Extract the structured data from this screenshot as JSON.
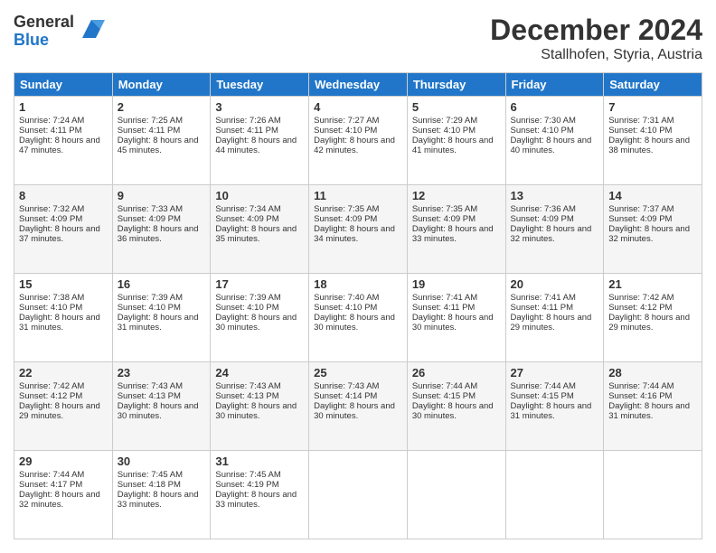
{
  "logo": {
    "general": "General",
    "blue": "Blue"
  },
  "header": {
    "month": "December 2024",
    "location": "Stallhofen, Styria, Austria"
  },
  "weekdays": [
    "Sunday",
    "Monday",
    "Tuesday",
    "Wednesday",
    "Thursday",
    "Friday",
    "Saturday"
  ],
  "weeks": [
    [
      {
        "day": "1",
        "sunrise": "Sunrise: 7:24 AM",
        "sunset": "Sunset: 4:11 PM",
        "daylight": "Daylight: 8 hours and 47 minutes."
      },
      {
        "day": "2",
        "sunrise": "Sunrise: 7:25 AM",
        "sunset": "Sunset: 4:11 PM",
        "daylight": "Daylight: 8 hours and 45 minutes."
      },
      {
        "day": "3",
        "sunrise": "Sunrise: 7:26 AM",
        "sunset": "Sunset: 4:11 PM",
        "daylight": "Daylight: 8 hours and 44 minutes."
      },
      {
        "day": "4",
        "sunrise": "Sunrise: 7:27 AM",
        "sunset": "Sunset: 4:10 PM",
        "daylight": "Daylight: 8 hours and 42 minutes."
      },
      {
        "day": "5",
        "sunrise": "Sunrise: 7:29 AM",
        "sunset": "Sunset: 4:10 PM",
        "daylight": "Daylight: 8 hours and 41 minutes."
      },
      {
        "day": "6",
        "sunrise": "Sunrise: 7:30 AM",
        "sunset": "Sunset: 4:10 PM",
        "daylight": "Daylight: 8 hours and 40 minutes."
      },
      {
        "day": "7",
        "sunrise": "Sunrise: 7:31 AM",
        "sunset": "Sunset: 4:10 PM",
        "daylight": "Daylight: 8 hours and 38 minutes."
      }
    ],
    [
      {
        "day": "8",
        "sunrise": "Sunrise: 7:32 AM",
        "sunset": "Sunset: 4:09 PM",
        "daylight": "Daylight: 8 hours and 37 minutes."
      },
      {
        "day": "9",
        "sunrise": "Sunrise: 7:33 AM",
        "sunset": "Sunset: 4:09 PM",
        "daylight": "Daylight: 8 hours and 36 minutes."
      },
      {
        "day": "10",
        "sunrise": "Sunrise: 7:34 AM",
        "sunset": "Sunset: 4:09 PM",
        "daylight": "Daylight: 8 hours and 35 minutes."
      },
      {
        "day": "11",
        "sunrise": "Sunrise: 7:35 AM",
        "sunset": "Sunset: 4:09 PM",
        "daylight": "Daylight: 8 hours and 34 minutes."
      },
      {
        "day": "12",
        "sunrise": "Sunrise: 7:35 AM",
        "sunset": "Sunset: 4:09 PM",
        "daylight": "Daylight: 8 hours and 33 minutes."
      },
      {
        "day": "13",
        "sunrise": "Sunrise: 7:36 AM",
        "sunset": "Sunset: 4:09 PM",
        "daylight": "Daylight: 8 hours and 32 minutes."
      },
      {
        "day": "14",
        "sunrise": "Sunrise: 7:37 AM",
        "sunset": "Sunset: 4:09 PM",
        "daylight": "Daylight: 8 hours and 32 minutes."
      }
    ],
    [
      {
        "day": "15",
        "sunrise": "Sunrise: 7:38 AM",
        "sunset": "Sunset: 4:10 PM",
        "daylight": "Daylight: 8 hours and 31 minutes."
      },
      {
        "day": "16",
        "sunrise": "Sunrise: 7:39 AM",
        "sunset": "Sunset: 4:10 PM",
        "daylight": "Daylight: 8 hours and 31 minutes."
      },
      {
        "day": "17",
        "sunrise": "Sunrise: 7:39 AM",
        "sunset": "Sunset: 4:10 PM",
        "daylight": "Daylight: 8 hours and 30 minutes."
      },
      {
        "day": "18",
        "sunrise": "Sunrise: 7:40 AM",
        "sunset": "Sunset: 4:10 PM",
        "daylight": "Daylight: 8 hours and 30 minutes."
      },
      {
        "day": "19",
        "sunrise": "Sunrise: 7:41 AM",
        "sunset": "Sunset: 4:11 PM",
        "daylight": "Daylight: 8 hours and 30 minutes."
      },
      {
        "day": "20",
        "sunrise": "Sunrise: 7:41 AM",
        "sunset": "Sunset: 4:11 PM",
        "daylight": "Daylight: 8 hours and 29 minutes."
      },
      {
        "day": "21",
        "sunrise": "Sunrise: 7:42 AM",
        "sunset": "Sunset: 4:12 PM",
        "daylight": "Daylight: 8 hours and 29 minutes."
      }
    ],
    [
      {
        "day": "22",
        "sunrise": "Sunrise: 7:42 AM",
        "sunset": "Sunset: 4:12 PM",
        "daylight": "Daylight: 8 hours and 29 minutes."
      },
      {
        "day": "23",
        "sunrise": "Sunrise: 7:43 AM",
        "sunset": "Sunset: 4:13 PM",
        "daylight": "Daylight: 8 hours and 30 minutes."
      },
      {
        "day": "24",
        "sunrise": "Sunrise: 7:43 AM",
        "sunset": "Sunset: 4:13 PM",
        "daylight": "Daylight: 8 hours and 30 minutes."
      },
      {
        "day": "25",
        "sunrise": "Sunrise: 7:43 AM",
        "sunset": "Sunset: 4:14 PM",
        "daylight": "Daylight: 8 hours and 30 minutes."
      },
      {
        "day": "26",
        "sunrise": "Sunrise: 7:44 AM",
        "sunset": "Sunset: 4:15 PM",
        "daylight": "Daylight: 8 hours and 30 minutes."
      },
      {
        "day": "27",
        "sunrise": "Sunrise: 7:44 AM",
        "sunset": "Sunset: 4:15 PM",
        "daylight": "Daylight: 8 hours and 31 minutes."
      },
      {
        "day": "28",
        "sunrise": "Sunrise: 7:44 AM",
        "sunset": "Sunset: 4:16 PM",
        "daylight": "Daylight: 8 hours and 31 minutes."
      }
    ],
    [
      {
        "day": "29",
        "sunrise": "Sunrise: 7:44 AM",
        "sunset": "Sunset: 4:17 PM",
        "daylight": "Daylight: 8 hours and 32 minutes."
      },
      {
        "day": "30",
        "sunrise": "Sunrise: 7:45 AM",
        "sunset": "Sunset: 4:18 PM",
        "daylight": "Daylight: 8 hours and 33 minutes."
      },
      {
        "day": "31",
        "sunrise": "Sunrise: 7:45 AM",
        "sunset": "Sunset: 4:19 PM",
        "daylight": "Daylight: 8 hours and 33 minutes."
      },
      null,
      null,
      null,
      null
    ]
  ]
}
